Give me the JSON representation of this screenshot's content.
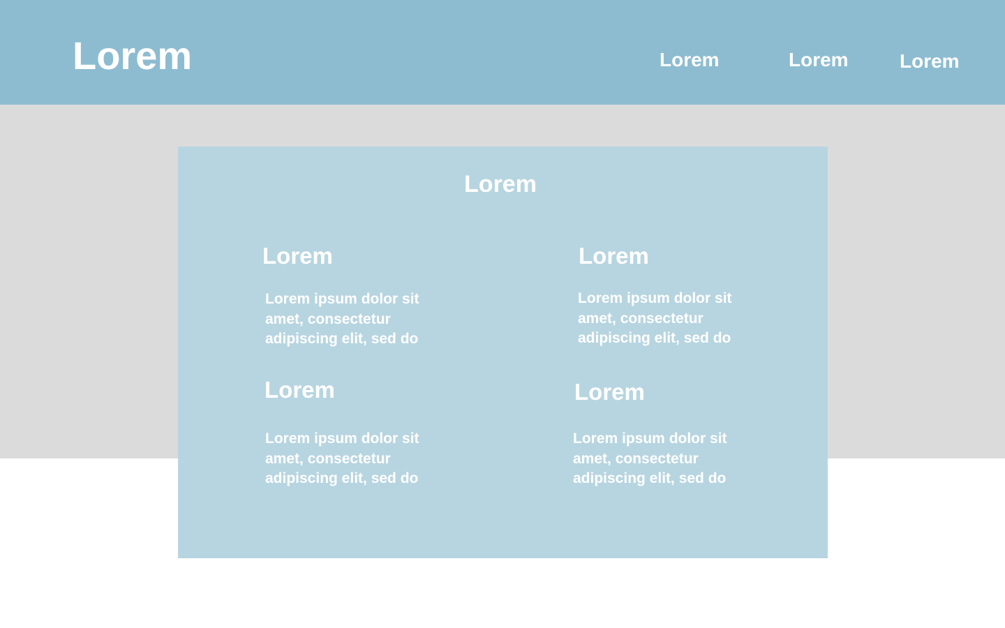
{
  "header": {
    "logo": "Lorem",
    "nav": [
      "Lorem",
      "Lorem",
      "Lorem"
    ]
  },
  "panel": {
    "title": "Lorem",
    "features": [
      {
        "title": "Lorem",
        "text": "Lorem ipsum dolor sit amet, consectetur adipiscing elit, sed do"
      },
      {
        "title": "Lorem",
        "text": "Lorem ipsum dolor sit amet, consectetur adipiscing elit, sed do"
      },
      {
        "title": "Lorem",
        "text": "Lorem ipsum dolor sit amet, consectetur adipiscing elit, sed do"
      },
      {
        "title": "Lorem",
        "text": "Lorem ipsum dolor sit amet, consectetur adipiscing elit, sed do"
      }
    ]
  },
  "colors": {
    "header_bg": "#8dbcd1",
    "band_bg": "#dbdbdb",
    "panel_bg": "#b7d5e0",
    "text": "#ffffff"
  }
}
